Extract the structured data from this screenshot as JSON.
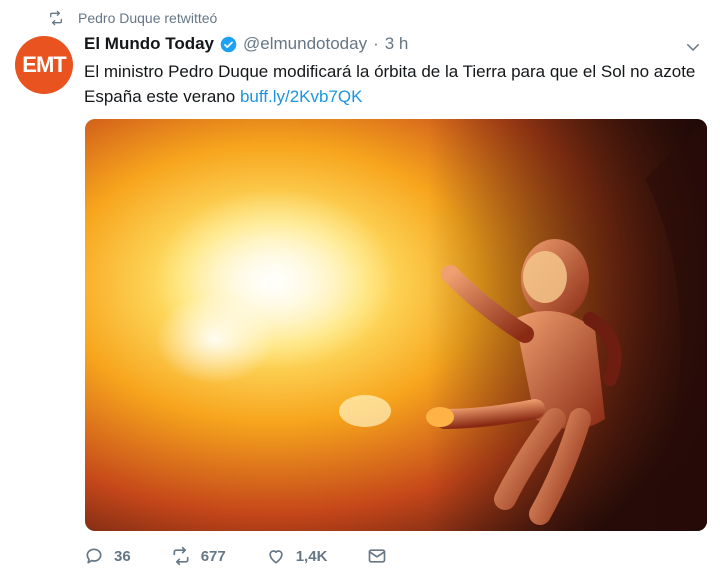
{
  "retweet": {
    "label": "Pedro Duque retwitteó",
    "icon": "retweet-icon"
  },
  "author": {
    "avatar_text": "EMT",
    "avatar_color": "#e8531f",
    "name": "El Mundo Today",
    "handle": "@elmundotoday",
    "separator": "·",
    "time": "3 h",
    "verified": true
  },
  "tweet": {
    "text": "El ministro Pedro Duque modificará la órbita de la Tierra para que el Sol no azote España este verano ",
    "link": "buff.ly/2Kvb7QK",
    "link_color": "#1b95e0"
  },
  "media": {
    "description_icon": "astronaut-near-sun-image"
  },
  "actions": {
    "replies": "36",
    "retweets": "677",
    "likes": "1,4K"
  }
}
